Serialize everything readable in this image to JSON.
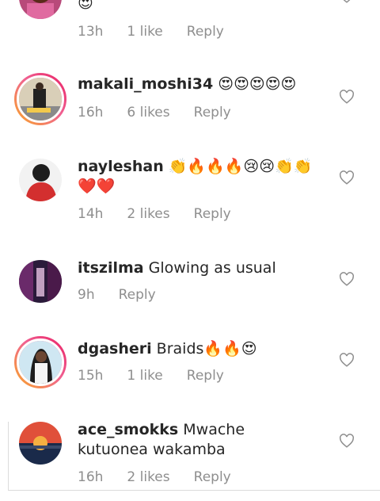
{
  "top_partial": {
    "emoji": "😍",
    "time": "13h",
    "likes": "1 like",
    "reply": "Reply"
  },
  "comments": [
    {
      "username": "makali_moshi34",
      "text": " 😍😍😍😍😍",
      "time": "16h",
      "likes": "6 likes",
      "reply": "Reply"
    },
    {
      "username": "nayleshan",
      "text": " 👏🔥🔥🔥😢😢👏👏❤️❤️",
      "time": "14h",
      "likes": "2 likes",
      "reply": "Reply"
    },
    {
      "username": "itszilma",
      "text": " Glowing as usual",
      "time": "9h",
      "likes": "",
      "reply": "Reply"
    },
    {
      "username": "dgasheri",
      "text": " Braids🔥🔥😍",
      "time": "15h",
      "likes": "1 like",
      "reply": "Reply"
    },
    {
      "username": "ace_smokks",
      "text": " Mwache kutuonea wakamba",
      "time": "16h",
      "likes": "2 likes",
      "reply": "Reply"
    }
  ],
  "colors": {
    "story_ring_start": "#f9a825",
    "story_ring_end": "#e91e63",
    "meta_gray": "#8e8e8e"
  }
}
